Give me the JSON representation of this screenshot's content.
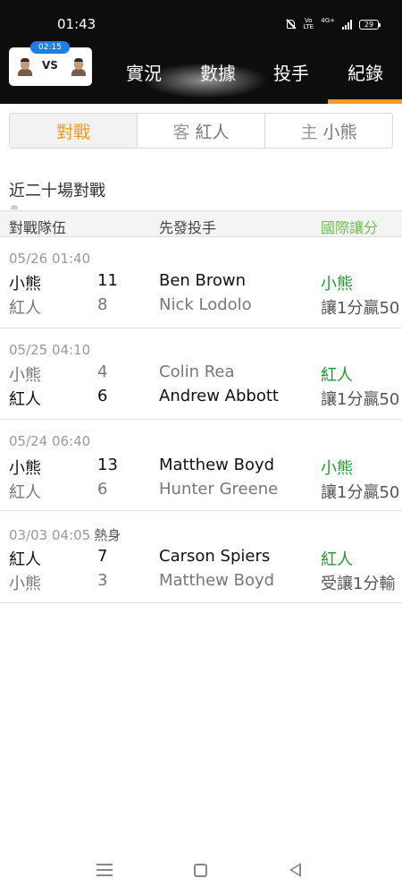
{
  "status_bar": {
    "time": "01:43",
    "network_top": "Vo",
    "network_bottom": "LTE",
    "data_label": "4G+",
    "battery": "29"
  },
  "header": {
    "game_time": "02:15",
    "vs_label": "VS",
    "tabs": [
      {
        "label": "實況",
        "active": false
      },
      {
        "label": "數據",
        "active": false
      },
      {
        "label": "投手",
        "active": false
      },
      {
        "label": "紀錄",
        "active": true
      }
    ],
    "accent_color": "#f39b1c"
  },
  "segment": {
    "items": [
      {
        "label": "對戰",
        "prefix": "",
        "team": ""
      },
      {
        "label": "",
        "prefix": "客",
        "team": "紅人"
      },
      {
        "label": "",
        "prefix": "主",
        "team": "小熊"
      }
    ]
  },
  "section": {
    "title": "近二十場對戰",
    "columns": {
      "teams": "對戰隊伍",
      "pitchers": "先發投手",
      "handicap": "國際讓分"
    }
  },
  "games": [
    {
      "date": "05/26 01:40",
      "note": "",
      "rows": [
        {
          "team": "小熊",
          "score": "11",
          "pitcher": "Ben Brown",
          "winner": true
        },
        {
          "team": "紅人",
          "score": "8",
          "pitcher": "Nick Lodolo",
          "winner": false
        }
      ],
      "result_team": "小熊",
      "result_text": "讓1分贏50"
    },
    {
      "date": "05/25 04:10",
      "note": "",
      "rows": [
        {
          "team": "小熊",
          "score": "4",
          "pitcher": "Colin Rea",
          "winner": false
        },
        {
          "team": "紅人",
          "score": "6",
          "pitcher": "Andrew Abbott",
          "winner": true
        }
      ],
      "result_team": "紅人",
      "result_text": "讓1分贏50"
    },
    {
      "date": "05/24 06:40",
      "note": "",
      "rows": [
        {
          "team": "小熊",
          "score": "13",
          "pitcher": "Matthew Boyd",
          "winner": true
        },
        {
          "team": "紅人",
          "score": "6",
          "pitcher": "Hunter Greene",
          "winner": false
        }
      ],
      "result_team": "小熊",
      "result_text": "讓1分贏50"
    },
    {
      "date": "03/03 04:05",
      "note": "熱身",
      "rows": [
        {
          "team": "紅人",
          "score": "7",
          "pitcher": "Carson Spiers",
          "winner": true
        },
        {
          "team": "小熊",
          "score": "3",
          "pitcher": "Matthew Boyd",
          "winner": false
        }
      ],
      "result_team": "紅人",
      "result_text": "受讓1分輸"
    }
  ],
  "colors": {
    "result_green": "#1e9c2a",
    "header_bg": "#0d0d0d",
    "pill_blue": "#1c7fe6"
  }
}
